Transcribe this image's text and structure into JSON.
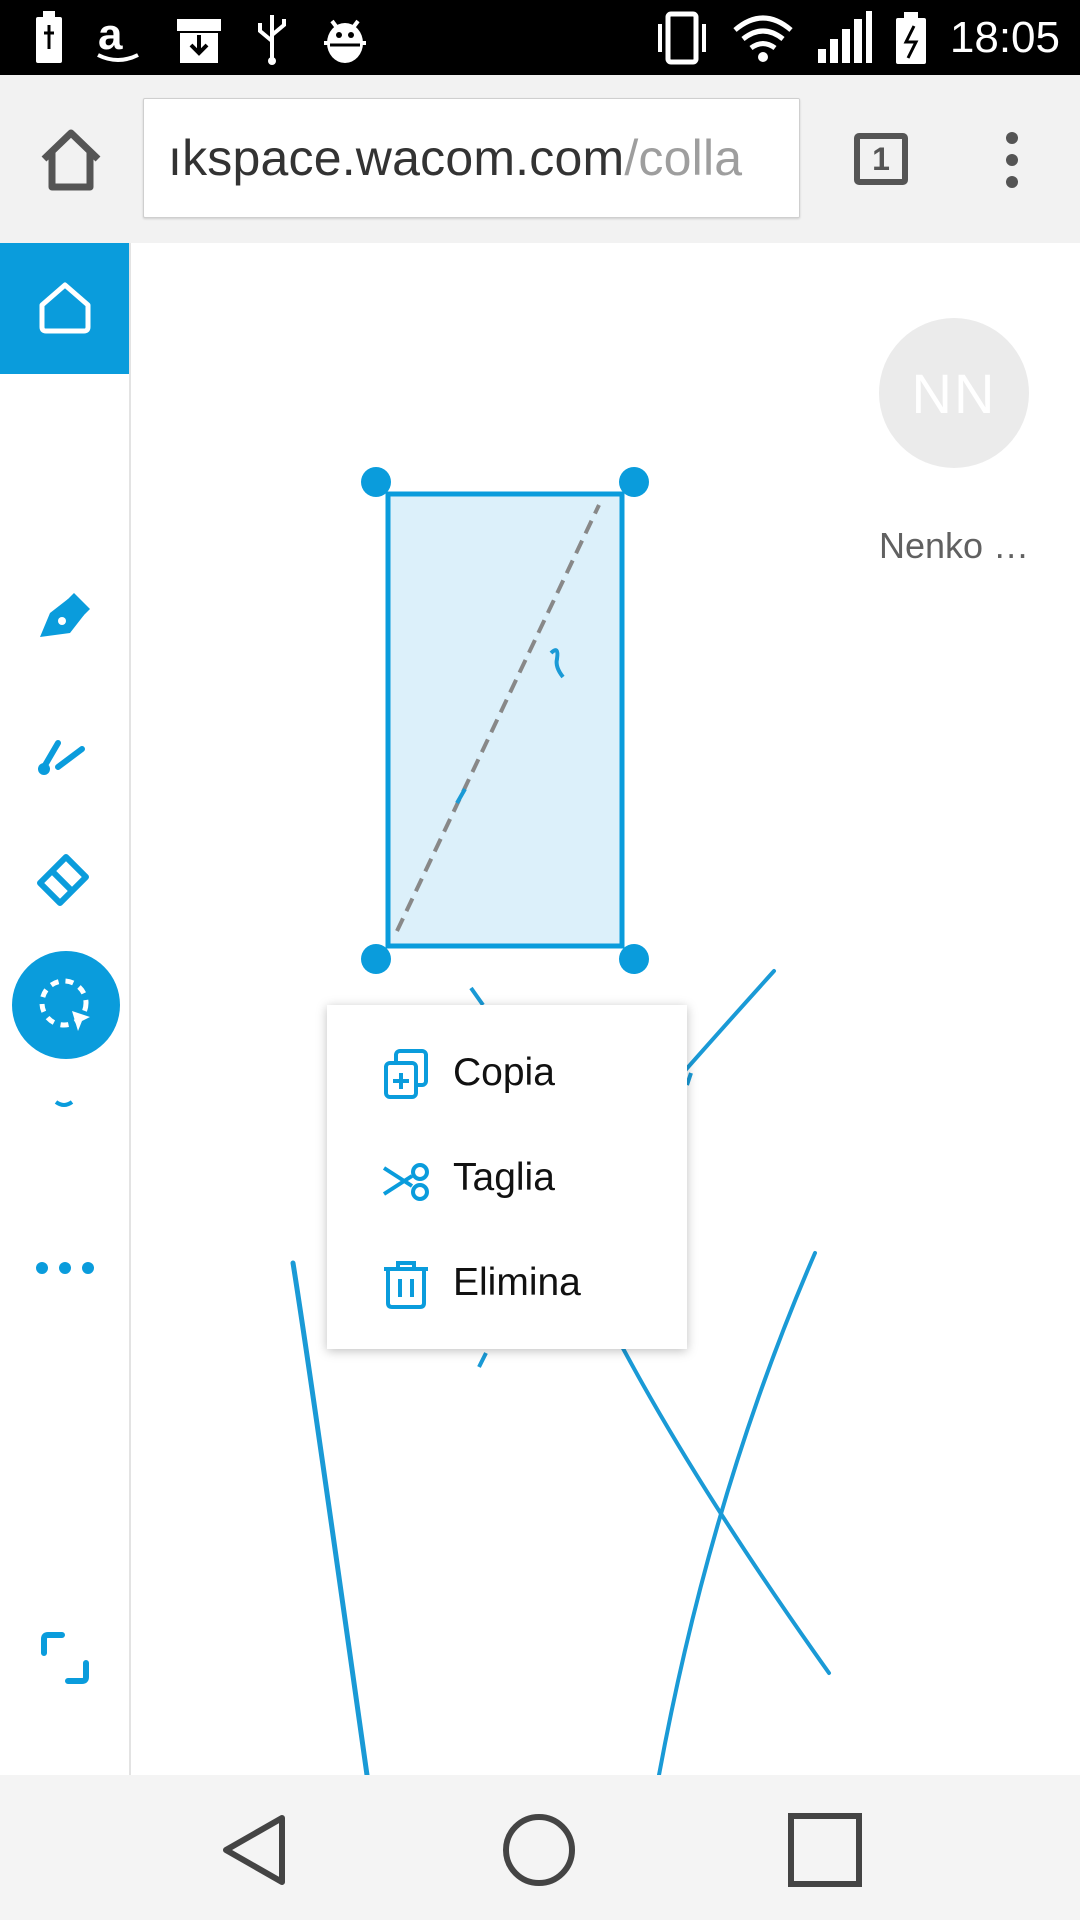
{
  "status_bar": {
    "time": "18:05",
    "left_icons": [
      "battery-charging-icon",
      "amazon-icon",
      "download-box-icon",
      "usb-icon",
      "android-debug-icon"
    ],
    "right_icons": [
      "vibrate-icon",
      "wifi-icon",
      "signal-icon",
      "battery-icon"
    ]
  },
  "browser": {
    "url_host": "ıkspace.wacom.com",
    "url_path": "/colla",
    "tab_count": "1"
  },
  "rail": {
    "tools": [
      "home-icon",
      "pen-icon",
      "brush-icon",
      "eraser-icon",
      "lasso-select-icon",
      "more-icon",
      "fullscreen-icon"
    ],
    "accent": "#0a9cdc"
  },
  "canvas": {
    "avatar_initials": "NN",
    "user_name": "Nenko …"
  },
  "context_menu": {
    "items": [
      {
        "label": "Copia",
        "icon": "copy-icon"
      },
      {
        "label": "Taglia",
        "icon": "cut-icon"
      },
      {
        "label": "Elimina",
        "icon": "trash-icon"
      }
    ]
  },
  "nav_bar": {
    "buttons": [
      "back-icon",
      "home-circle-icon",
      "recents-icon"
    ]
  }
}
